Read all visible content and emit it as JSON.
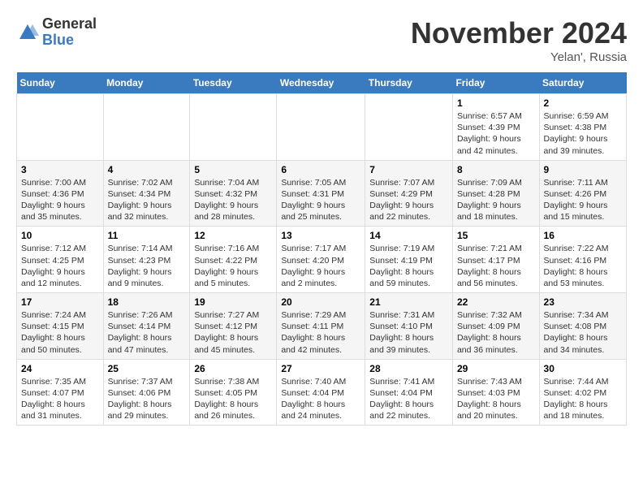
{
  "logo": {
    "general": "General",
    "blue": "Blue"
  },
  "title": "November 2024",
  "location": "Yelan', Russia",
  "days_of_week": [
    "Sunday",
    "Monday",
    "Tuesday",
    "Wednesday",
    "Thursday",
    "Friday",
    "Saturday"
  ],
  "weeks": [
    [
      {
        "day": "",
        "content": ""
      },
      {
        "day": "",
        "content": ""
      },
      {
        "day": "",
        "content": ""
      },
      {
        "day": "",
        "content": ""
      },
      {
        "day": "",
        "content": ""
      },
      {
        "day": "1",
        "content": "Sunrise: 6:57 AM\nSunset: 4:39 PM\nDaylight: 9 hours\nand 42 minutes."
      },
      {
        "day": "2",
        "content": "Sunrise: 6:59 AM\nSunset: 4:38 PM\nDaylight: 9 hours\nand 39 minutes."
      }
    ],
    [
      {
        "day": "3",
        "content": "Sunrise: 7:00 AM\nSunset: 4:36 PM\nDaylight: 9 hours\nand 35 minutes."
      },
      {
        "day": "4",
        "content": "Sunrise: 7:02 AM\nSunset: 4:34 PM\nDaylight: 9 hours\nand 32 minutes."
      },
      {
        "day": "5",
        "content": "Sunrise: 7:04 AM\nSunset: 4:32 PM\nDaylight: 9 hours\nand 28 minutes."
      },
      {
        "day": "6",
        "content": "Sunrise: 7:05 AM\nSunset: 4:31 PM\nDaylight: 9 hours\nand 25 minutes."
      },
      {
        "day": "7",
        "content": "Sunrise: 7:07 AM\nSunset: 4:29 PM\nDaylight: 9 hours\nand 22 minutes."
      },
      {
        "day": "8",
        "content": "Sunrise: 7:09 AM\nSunset: 4:28 PM\nDaylight: 9 hours\nand 18 minutes."
      },
      {
        "day": "9",
        "content": "Sunrise: 7:11 AM\nSunset: 4:26 PM\nDaylight: 9 hours\nand 15 minutes."
      }
    ],
    [
      {
        "day": "10",
        "content": "Sunrise: 7:12 AM\nSunset: 4:25 PM\nDaylight: 9 hours\nand 12 minutes."
      },
      {
        "day": "11",
        "content": "Sunrise: 7:14 AM\nSunset: 4:23 PM\nDaylight: 9 hours\nand 9 minutes."
      },
      {
        "day": "12",
        "content": "Sunrise: 7:16 AM\nSunset: 4:22 PM\nDaylight: 9 hours\nand 5 minutes."
      },
      {
        "day": "13",
        "content": "Sunrise: 7:17 AM\nSunset: 4:20 PM\nDaylight: 9 hours\nand 2 minutes."
      },
      {
        "day": "14",
        "content": "Sunrise: 7:19 AM\nSunset: 4:19 PM\nDaylight: 8 hours\nand 59 minutes."
      },
      {
        "day": "15",
        "content": "Sunrise: 7:21 AM\nSunset: 4:17 PM\nDaylight: 8 hours\nand 56 minutes."
      },
      {
        "day": "16",
        "content": "Sunrise: 7:22 AM\nSunset: 4:16 PM\nDaylight: 8 hours\nand 53 minutes."
      }
    ],
    [
      {
        "day": "17",
        "content": "Sunrise: 7:24 AM\nSunset: 4:15 PM\nDaylight: 8 hours\nand 50 minutes."
      },
      {
        "day": "18",
        "content": "Sunrise: 7:26 AM\nSunset: 4:14 PM\nDaylight: 8 hours\nand 47 minutes."
      },
      {
        "day": "19",
        "content": "Sunrise: 7:27 AM\nSunset: 4:12 PM\nDaylight: 8 hours\nand 45 minutes."
      },
      {
        "day": "20",
        "content": "Sunrise: 7:29 AM\nSunset: 4:11 PM\nDaylight: 8 hours\nand 42 minutes."
      },
      {
        "day": "21",
        "content": "Sunrise: 7:31 AM\nSunset: 4:10 PM\nDaylight: 8 hours\nand 39 minutes."
      },
      {
        "day": "22",
        "content": "Sunrise: 7:32 AM\nSunset: 4:09 PM\nDaylight: 8 hours\nand 36 minutes."
      },
      {
        "day": "23",
        "content": "Sunrise: 7:34 AM\nSunset: 4:08 PM\nDaylight: 8 hours\nand 34 minutes."
      }
    ],
    [
      {
        "day": "24",
        "content": "Sunrise: 7:35 AM\nSunset: 4:07 PM\nDaylight: 8 hours\nand 31 minutes."
      },
      {
        "day": "25",
        "content": "Sunrise: 7:37 AM\nSunset: 4:06 PM\nDaylight: 8 hours\nand 29 minutes."
      },
      {
        "day": "26",
        "content": "Sunrise: 7:38 AM\nSunset: 4:05 PM\nDaylight: 8 hours\nand 26 minutes."
      },
      {
        "day": "27",
        "content": "Sunrise: 7:40 AM\nSunset: 4:04 PM\nDaylight: 8 hours\nand 24 minutes."
      },
      {
        "day": "28",
        "content": "Sunrise: 7:41 AM\nSunset: 4:04 PM\nDaylight: 8 hours\nand 22 minutes."
      },
      {
        "day": "29",
        "content": "Sunrise: 7:43 AM\nSunset: 4:03 PM\nDaylight: 8 hours\nand 20 minutes."
      },
      {
        "day": "30",
        "content": "Sunrise: 7:44 AM\nSunset: 4:02 PM\nDaylight: 8 hours\nand 18 minutes."
      }
    ]
  ]
}
